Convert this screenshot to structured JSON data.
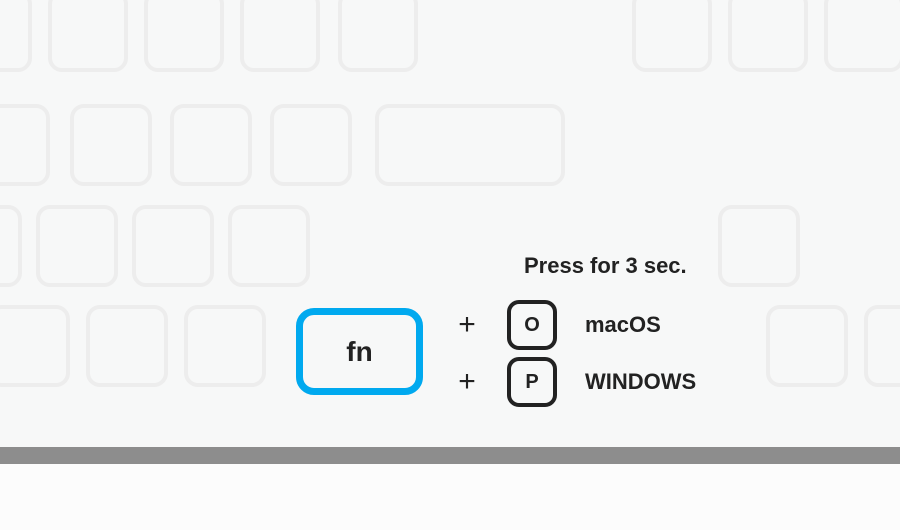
{
  "instruction": "Press for 3 sec.",
  "fn_key": {
    "label": "fn"
  },
  "combos": {
    "macos": {
      "plus": "+",
      "key": "O",
      "os_label": "macOS"
    },
    "windows": {
      "plus": "+",
      "key": "P",
      "os_label": "WINDOWS"
    }
  },
  "colors": {
    "accent": "#00a9ef",
    "key_outline": "#222222",
    "bg_key": "#ededed",
    "deck": "#8d8d8d"
  }
}
